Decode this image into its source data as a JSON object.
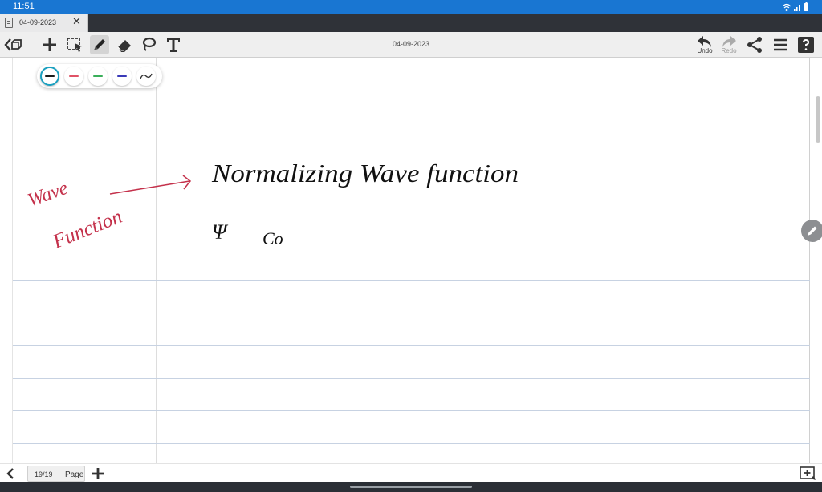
{
  "status_bar": {
    "time": "11:51"
  },
  "tab": {
    "title": "04-09-2023"
  },
  "toolbar": {
    "title": "04-09-2023",
    "undo_label": "Undo",
    "redo_label": "Redo"
  },
  "palette": {
    "colors": [
      "#1a1a1a",
      "#e05266",
      "#3aaf5a",
      "#3a3ab8",
      "#333333"
    ],
    "selected_index": 0
  },
  "notes": {
    "annotation": [
      "Wave",
      "Function"
    ],
    "heading": "Normalizing Wave function",
    "line2": [
      "Ψ",
      "Co"
    ]
  },
  "bottom_bar": {
    "page_number": "19/19",
    "page_label": "Page"
  }
}
